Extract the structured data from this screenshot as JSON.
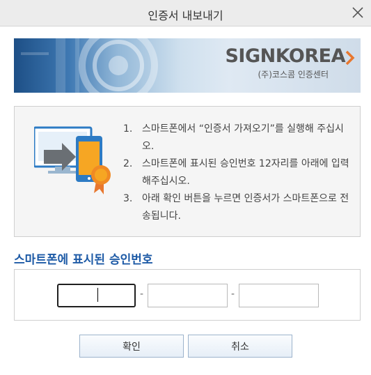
{
  "window": {
    "title": "인증서 내보내기"
  },
  "banner": {
    "logo_text": "SIGNKOREA",
    "logo_subtitle": "(주)코스콤 인증센터"
  },
  "instructions": [
    {
      "num": "1.",
      "text": "스마트폰에서 “인증서 가져오기”를 실행해 주십시오."
    },
    {
      "num": "2.",
      "text": "스마트폰에 표시된 승인번호 12자리를 아래에 입력해주십시오."
    },
    {
      "num": "3.",
      "text": "아래 확인 버튼을 누르면 인증서가 스마트폰으로 전송됩니다."
    }
  ],
  "approval": {
    "heading": "스마트폰에 표시된 승인번호",
    "separator": "-",
    "fields": [
      "",
      "",
      ""
    ]
  },
  "buttons": {
    "ok": "확인",
    "cancel": "취소"
  },
  "colors": {
    "heading": "#1d5aa6",
    "logo_accent": "#e8772e"
  }
}
